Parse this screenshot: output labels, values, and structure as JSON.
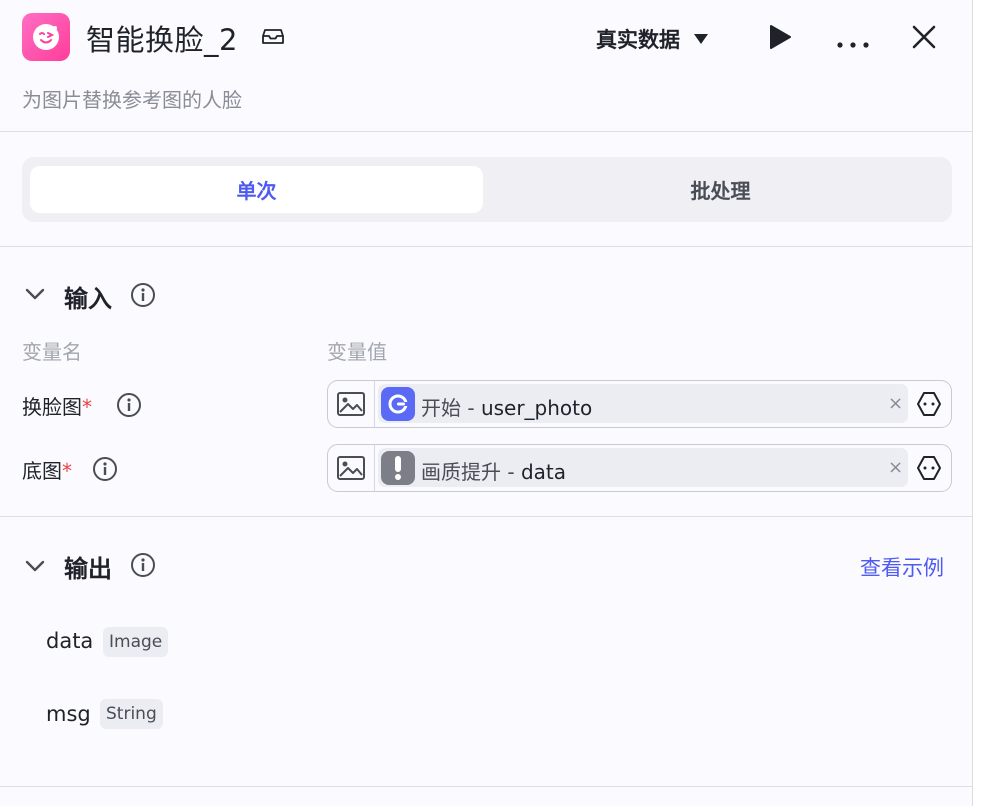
{
  "header": {
    "title": "智能换脸_2",
    "subtitle": "为图片替换参考图的人脸",
    "data_mode": "真实数据",
    "app_icon": "face-wink-icon",
    "accent_color": "#4e5bf0"
  },
  "tabs": [
    {
      "label": "单次",
      "active": true
    },
    {
      "label": "批处理",
      "active": false
    }
  ],
  "input": {
    "title": "输入",
    "col_name": "变量名",
    "col_value": "变量值",
    "rows": [
      {
        "label": "换脸图",
        "required": "*",
        "node": "开始",
        "var": "user_photo",
        "node_icon": "start-node-icon",
        "clear": "×"
      },
      {
        "label": "底图",
        "required": "*",
        "node": "画质提升",
        "var": "data",
        "node_icon": "warning-node-icon",
        "clear": "×"
      }
    ]
  },
  "output": {
    "title": "输出",
    "example_link": "查看示例",
    "items": [
      {
        "name": "data",
        "type": "Image"
      },
      {
        "name": "msg",
        "type": "String"
      }
    ]
  }
}
